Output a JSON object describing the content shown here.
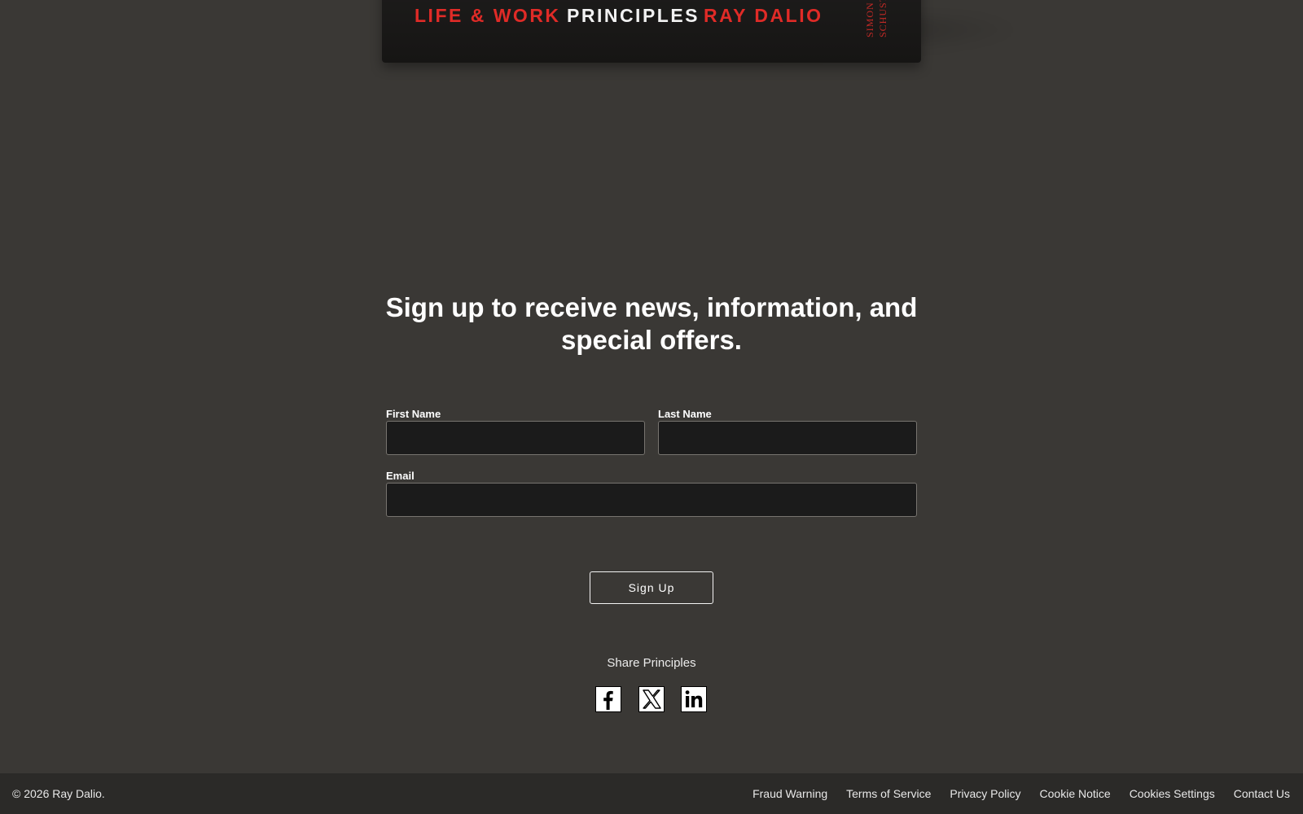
{
  "book": {
    "subtitle": "LIFE & WORK",
    "title": "PRINCIPLES",
    "author": "RAY DALIO",
    "publisher_line1": "SIMON",
    "publisher_line2": "SCHUSTE"
  },
  "signup": {
    "headline": "Sign up to receive news, information, and special offers.",
    "first_name_label": "First Name",
    "first_name_value": "",
    "last_name_label": "Last Name",
    "last_name_value": "",
    "email_label": "Email",
    "email_value": "",
    "button_label": "Sign Up"
  },
  "share": {
    "label": "Share Principles",
    "icons": [
      "facebook-icon",
      "x-icon",
      "linkedin-icon"
    ]
  },
  "footer": {
    "copyright": "© 2026 Ray Dalio.",
    "links": [
      {
        "label": "Fraud Warning"
      },
      {
        "label": "Terms of Service"
      },
      {
        "label": "Privacy Policy"
      },
      {
        "label": "Cookie Notice"
      },
      {
        "label": "Cookies Settings"
      },
      {
        "label": "Contact Us"
      }
    ]
  },
  "colors": {
    "background": "#3a3835",
    "footer_background": "#2b2a28",
    "input_background": "#1b1b1b",
    "accent_red": "#e02b27"
  }
}
